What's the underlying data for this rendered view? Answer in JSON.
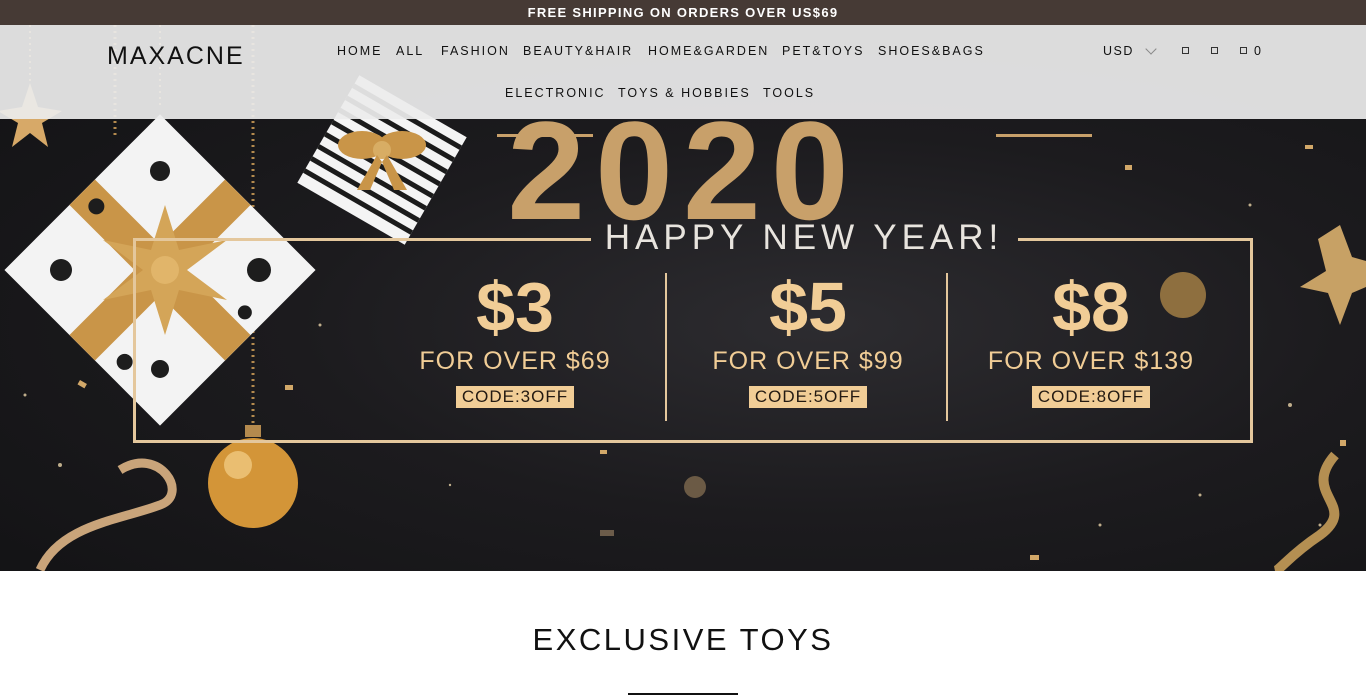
{
  "announcement": "FREE SHIPPING ON ORDERS OVER US$69",
  "brand": "MAXACNE",
  "nav": [
    "HOME",
    "ALL",
    "FASHION",
    "BEAUTY&HAIR",
    "HOME&GARDEN",
    "PET&TOYS",
    "SHOES&BAGS",
    "ELECTRONIC",
    "TOYS & HOBBIES",
    "TOOLS"
  ],
  "header_right": {
    "currency": "USD",
    "cart_count": "0"
  },
  "hero": {
    "year": "2020",
    "greeting": "HAPPY NEW YEAR!",
    "offers": [
      {
        "amount": "$3",
        "condition": "FOR OVER $69",
        "code": "CODE:3OFF"
      },
      {
        "amount": "$5",
        "condition": "FOR OVER $99",
        "code": "CODE:5OFF"
      },
      {
        "amount": "$8",
        "condition": "FOR OVER $139",
        "code": "CODE:8OFF"
      }
    ]
  },
  "section": {
    "title": "EXCLUSIVE TOYS"
  },
  "colors": {
    "announcement_bg": "#463a35",
    "gold": "#c8a06a",
    "offer_text": "#f1cd96"
  },
  "icons": [
    "search-icon",
    "account-icon",
    "cart-icon",
    "chevron-down-icon"
  ]
}
